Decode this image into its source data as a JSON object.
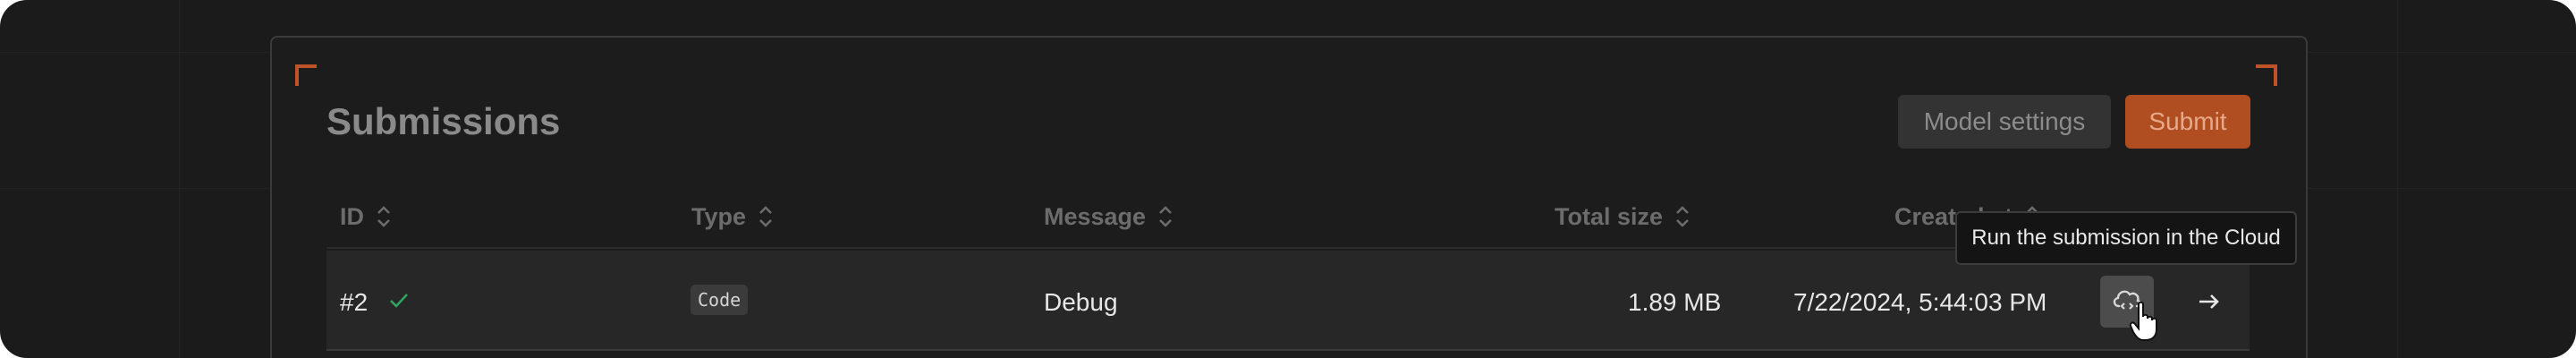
{
  "header": {
    "title": "Submissions",
    "model_settings_label": "Model settings",
    "submit_label": "Submit"
  },
  "table": {
    "columns": [
      {
        "label": "ID",
        "sortable": true
      },
      {
        "label": "Type",
        "sortable": true
      },
      {
        "label": "Message",
        "sortable": true
      },
      {
        "label": "Total size",
        "sortable": true
      },
      {
        "label": "Created at",
        "sortable": true
      }
    ],
    "rows": [
      {
        "id": "#2",
        "status_icon": "check-icon",
        "type": "Code",
        "message": "Debug",
        "total_size": "1.89 MB",
        "created_at": "7/22/2024, 5:44:03 PM"
      }
    ]
  },
  "tooltip": {
    "text": "Run the submission in the Cloud"
  },
  "icons": {
    "run_cloud": "cloud-run-icon",
    "open": "arrow-right-icon",
    "sort": "sort-icon"
  },
  "colors": {
    "accent": "#b04e22",
    "success": "#2fa45e",
    "background": "#1b1b1b"
  }
}
